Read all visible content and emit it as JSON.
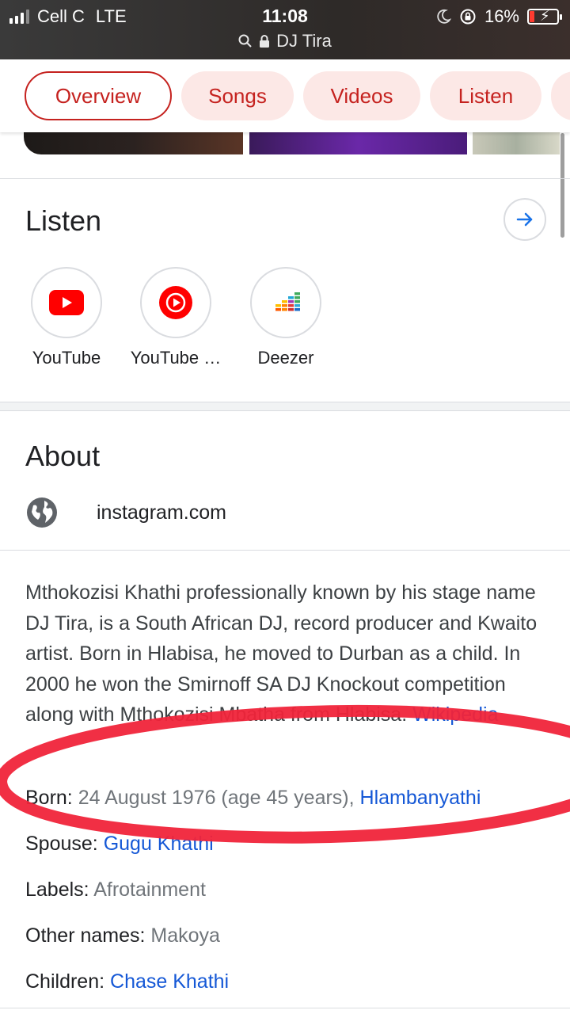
{
  "status_bar": {
    "carrier": "Cell C",
    "network": "LTE",
    "time": "11:08",
    "url": "DJ Tira",
    "battery": "16%"
  },
  "tabs": [
    "Overview",
    "Songs",
    "Videos",
    "Listen"
  ],
  "listen": {
    "title": "Listen",
    "providers": [
      {
        "label": "YouTube",
        "icon": "youtube-icon"
      },
      {
        "label": "YouTube …",
        "icon": "youtube-music-icon"
      },
      {
        "label": "Deezer",
        "icon": "deezer-icon"
      }
    ]
  },
  "about": {
    "title": "About",
    "website": "instagram.com",
    "description": "Mthokozisi Khathi professionally known by his stage name DJ Tira, is a South African DJ, record producer and Kwaito artist. Born in Hlabisa, he moved to Durban as a child. In 2000 he won the Smirnoff SA DJ Knockout competition along with Mthokozisi Mbatha from Hlabisa.",
    "source": "Wikipedia",
    "facts": {
      "born": {
        "label": "Born:",
        "value": "24 August 1976 (age 45 years),",
        "link": "Hlambanyathi"
      },
      "spouse": {
        "label": "Spouse:",
        "link": "Gugu Khathi"
      },
      "labels": {
        "label": "Labels:",
        "value": "Afrotainment"
      },
      "other_names": {
        "label": "Other names:",
        "value": "Makoya"
      },
      "children": {
        "label": "Children:",
        "link": "Chase Khathi"
      }
    }
  },
  "colors": {
    "accent_red": "#c5221f",
    "chip_bg": "#fce8e6",
    "link_blue": "#1558d6",
    "annotation_red": "#f0243a"
  }
}
